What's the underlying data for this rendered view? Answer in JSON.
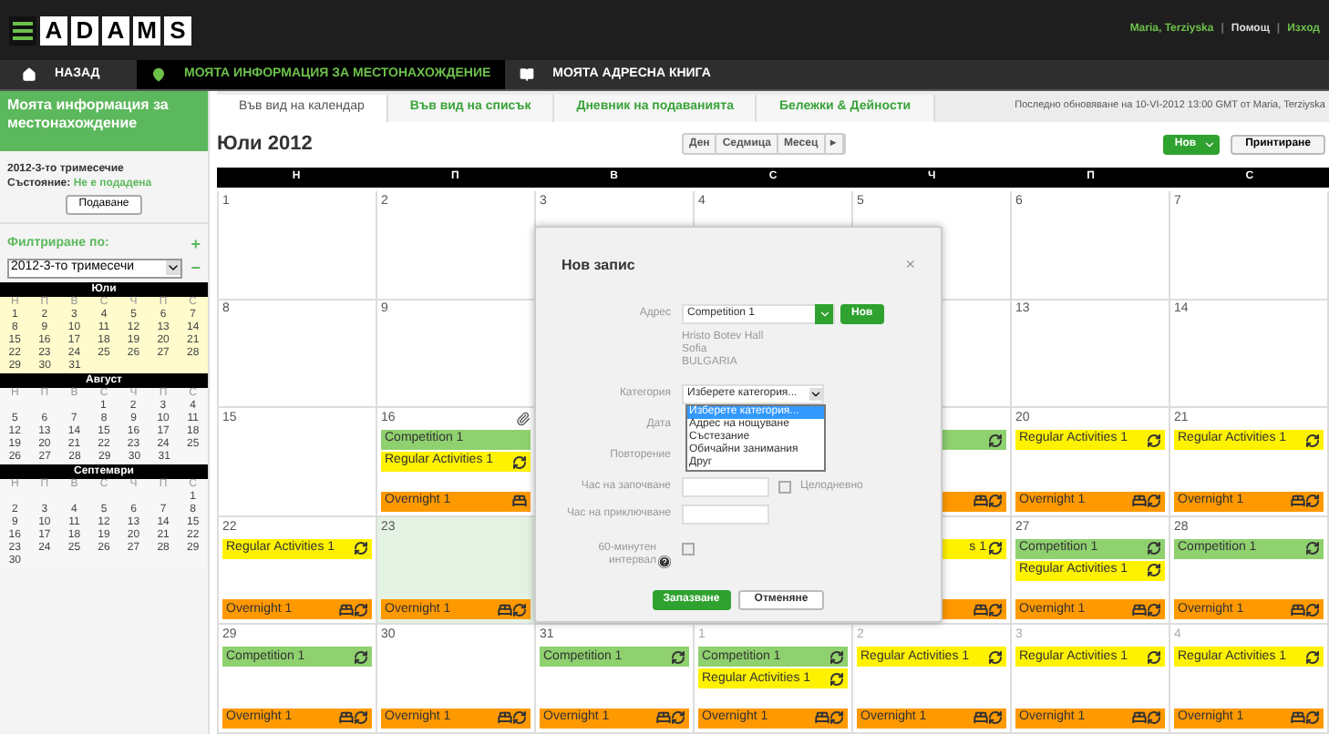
{
  "header": {
    "logo": [
      "A",
      "D",
      "A",
      "M",
      "S"
    ],
    "user": "Maria, Terziyska",
    "separators": [
      "|",
      "|"
    ],
    "links": [
      "Помощ",
      "Изход"
    ]
  },
  "nav": [
    {
      "kind": "home",
      "label": "НАЗАД",
      "selected": false
    },
    {
      "kind": "pin",
      "label": "МОЯТА ИНФОРМАЦИЯ ЗА МЕСТОНАХОЖДЕНИЕ",
      "selected": true
    },
    {
      "kind": "book",
      "label": "МОЯТА АДРЕСНА КНИГА",
      "selected": false
    }
  ],
  "sidebar": {
    "title": "Моята информация за местонахождение",
    "quarter": "2012-3-то тримесечие",
    "status_label": "Състояние:",
    "status_value": "Не е подадена",
    "submit": "Подаване",
    "filter_label": "Филтриране по:",
    "add": "+",
    "remove": "−",
    "filter_value": "2012-3-то тримесечи",
    "months": [
      {
        "name": "Юли",
        "selected": true,
        "weekdays": [
          "Н",
          "П",
          "В",
          "С",
          "Ч",
          "П",
          "С"
        ],
        "weeks": [
          {
            "days": [
              "1",
              "2",
              "3",
              "4",
              "5",
              "6",
              "7"
            ]
          },
          {
            "days": [
              "8",
              "9",
              "10",
              "11",
              "12",
              "13",
              "14"
            ]
          },
          {
            "days": [
              "15",
              "16",
              "17",
              "18",
              "19",
              "20",
              "21"
            ]
          },
          {
            "days": [
              "22",
              "23",
              "24",
              "25",
              "26",
              "27",
              "28"
            ]
          },
          {
            "days": [
              "29",
              "30",
              "31"
            ]
          }
        ]
      },
      {
        "name": "Август",
        "selected": false,
        "weekdays": [
          "Н",
          "П",
          "В",
          "С",
          "Ч",
          "П",
          "С"
        ],
        "weeks": [
          {
            "pad_start": true,
            "days": [
              "1",
              "2",
              "3",
              "4"
            ]
          },
          {
            "days": [
              "5",
              "6",
              "7",
              "8",
              "9",
              "10",
              "11"
            ]
          },
          {
            "days": [
              "12",
              "13",
              "14",
              "15",
              "16",
              "17",
              "18"
            ]
          },
          {
            "days": [
              "19",
              "20",
              "21",
              "22",
              "23",
              "24",
              "25"
            ]
          },
          {
            "days": [
              "26",
              "27",
              "28",
              "29",
              "30",
              "31"
            ]
          }
        ]
      },
      {
        "name": "Септември",
        "selected": false,
        "weekdays": [
          "Н",
          "П",
          "В",
          "С",
          "Ч",
          "П",
          "С"
        ],
        "weeks": [
          {
            "pad_start": true,
            "days": [
              "1"
            ]
          },
          {
            "days": [
              "2",
              "3",
              "4",
              "5",
              "6",
              "7",
              "8"
            ]
          },
          {
            "days": [
              "9",
              "10",
              "11",
              "12",
              "13",
              "14",
              "15"
            ]
          },
          {
            "days": [
              "16",
              "17",
              "18",
              "19",
              "20",
              "21",
              "22"
            ]
          },
          {
            "days": [
              "23",
              "24",
              "25",
              "26",
              "27",
              "28",
              "29"
            ]
          },
          {
            "days": [
              "30"
            ]
          }
        ]
      }
    ]
  },
  "tabs": [
    {
      "label": "Във вид на календар",
      "selected": true
    },
    {
      "label": "Във вид на списък",
      "selected": false
    },
    {
      "label": "Дневник на подаванията",
      "selected": false
    },
    {
      "label": "Бележки & Дейности",
      "selected": false
    }
  ],
  "last_updated": "Последно обновяване на 10-VI-2012 13:00 GMT от Maria, Terziyska",
  "toolbar": {
    "title": "Юли 2012",
    "views": [
      "Ден",
      "Седмица",
      "Месец",
      "▸"
    ],
    "new": "Нов",
    "print": "Принтиране"
  },
  "calendar": {
    "weekdays": [
      "Н",
      "П",
      "В",
      "С",
      "Ч",
      "П",
      "С"
    ],
    "weeks": [
      {
        "days": [
          {
            "day": "1",
            "selected": false,
            "other_month": false
          },
          {
            "day": "2",
            "selected": false,
            "other_month": false
          },
          {
            "day": "3",
            "selected": false,
            "other_month": false
          },
          {
            "day": "4",
            "selected": false,
            "other_month": false
          },
          {
            "day": "5",
            "selected": false,
            "other_month": false
          },
          {
            "day": "6",
            "selected": false,
            "other_month": false
          },
          {
            "day": "7",
            "selected": false,
            "other_month": false
          }
        ]
      },
      {
        "covered": true,
        "days": [
          {
            "day": "8",
            "selected": false,
            "other_month": false
          },
          {
            "day": "9",
            "selected": false,
            "other_month": false
          },
          {
            "selected": false
          },
          {
            "day": "13",
            "selected": false,
            "other_month": false
          },
          {
            "day": "14",
            "selected": false,
            "other_month": false
          }
        ]
      },
      {
        "covered": true,
        "days": [
          {
            "day": "15",
            "selected": false,
            "other_month": false
          },
          {
            "day": "16",
            "selected": false,
            "other_month": false,
            "attachment": true,
            "events": [
              {
                "kind": "competition",
                "label": "Competition 1",
                "recurring": false
              },
              {
                "kind": "regular",
                "label": "Regular Activities 1",
                "recurring": true
              },
              {
                "kind": "overnight",
                "label": "Overnight 1",
                "recurring": false
              }
            ]
          },
          {
            "selected": false,
            "events": [
              {
                "kind": "competition",
                "recurring": true
              },
              {
                "kind": "overnight",
                "recurring": true
              }
            ]
          },
          {
            "day": "20",
            "selected": false,
            "other_month": false,
            "events": [
              {
                "kind": "regular",
                "label": "Regular Activities 1",
                "recurring": true
              },
              {
                "kind": "overnight",
                "label": "Overnight 1",
                "recurring": true
              }
            ]
          },
          {
            "day": "21",
            "selected": false,
            "other_month": false,
            "events": [
              {
                "kind": "regular",
                "label": "Regular Activities 1",
                "recurring": true
              },
              {
                "kind": "overnight",
                "label": "Overnight 1",
                "recurring": true
              }
            ]
          }
        ]
      },
      {
        "covered": true,
        "days": [
          {
            "day": "22",
            "selected": false,
            "other_month": false,
            "events": [
              {
                "kind": "regular",
                "label": "Regular Activities 1",
                "recurring": true
              },
              {
                "kind": "overnight",
                "label": "Overnight 1",
                "recurring": true
              }
            ]
          },
          {
            "day": "23",
            "selected": true,
            "other_month": false,
            "events": [
              {
                "kind": "overnight",
                "label": "Overnight 1",
                "recurring": true
              }
            ]
          },
          {
            "selected": false,
            "events": [
              {
                "kind": "regular",
                "label": "s 1",
                "clipped": true,
                "recurring": true
              },
              {
                "kind": "overnight",
                "recurring": true
              }
            ]
          },
          {
            "day": "27",
            "selected": false,
            "other_month": false,
            "events": [
              {
                "kind": "competition",
                "label": "Competition 1",
                "recurring": true
              },
              {
                "kind": "regular",
                "label": "Regular Activities 1",
                "recurring": true
              },
              {
                "kind": "overnight",
                "label": "Overnight 1",
                "recurring": true
              }
            ]
          },
          {
            "day": "28",
            "selected": false,
            "other_month": false,
            "events": [
              {
                "kind": "competition",
                "label": "Competition 1",
                "recurring": true
              },
              {
                "kind": "overnight",
                "label": "Overnight 1",
                "recurring": true
              }
            ]
          }
        ]
      },
      {
        "days": [
          {
            "day": "29",
            "selected": false,
            "other_month": false,
            "events": [
              {
                "kind": "competition",
                "label": "Competition 1",
                "recurring": true
              },
              {
                "kind": "overnight",
                "label": "Overnight 1",
                "recurring": true
              }
            ]
          },
          {
            "day": "30",
            "selected": false,
            "other_month": false,
            "events": [
              {
                "kind": "overnight",
                "label": "Overnight 1",
                "recurring": true
              }
            ]
          },
          {
            "day": "31",
            "selected": false,
            "other_month": false,
            "events": [
              {
                "kind": "competition",
                "label": "Competition 1",
                "recurring": true
              },
              {
                "kind": "overnight",
                "label": "Overnight 1",
                "recurring": true
              }
            ]
          },
          {
            "day": "1",
            "selected": false,
            "other_month": true,
            "events": [
              {
                "kind": "competition",
                "label": "Competition 1",
                "recurring": true
              },
              {
                "kind": "regular",
                "label": "Regular Activities 1",
                "recurring": true
              },
              {
                "kind": "overnight",
                "label": "Overnight 1",
                "recurring": true
              }
            ]
          },
          {
            "day": "2",
            "selected": false,
            "other_month": true,
            "events": [
              {
                "kind": "regular",
                "label": "Regular Activities 1",
                "recurring": true
              },
              {
                "kind": "overnight",
                "label": "Overnight 1",
                "recurring": true
              }
            ]
          },
          {
            "day": "3",
            "selected": false,
            "other_month": true,
            "events": [
              {
                "kind": "regular",
                "label": "Regular Activities 1",
                "recurring": true
              },
              {
                "kind": "overnight",
                "label": "Overnight 1",
                "recurring": true
              }
            ]
          },
          {
            "day": "4",
            "selected": false,
            "other_month": true,
            "events": [
              {
                "kind": "regular",
                "label": "Regular Activities 1",
                "recurring": true
              },
              {
                "kind": "overnight",
                "label": "Overnight 1",
                "recurring": true
              }
            ]
          }
        ]
      }
    ]
  },
  "dialog": {
    "title": "Нов запис",
    "close": "×",
    "address_label": "Адрес",
    "address_value": "Competition 1",
    "new": "Нов",
    "address_lines": [
      "Hristo Botev Hall",
      "Sofia",
      "BULGARIA"
    ],
    "category_label": "Категория",
    "category_value": "Изберете категория...",
    "category_options": [
      {
        "label": "Изберете категория...",
        "selected": true
      },
      {
        "label": "Адрес на нощуване",
        "selected": false
      },
      {
        "label": "Състезание",
        "selected": false
      },
      {
        "label": "Обичайни занимания",
        "selected": false
      },
      {
        "label": "Друг",
        "selected": false
      }
    ],
    "date_label": "Дата",
    "repeat_label": "Повторение",
    "start_label": "Час на започване",
    "all_day_label": "Целодневно",
    "all_day": false,
    "end_label": "Час на приключване",
    "interval_label": "60-минутен интервал",
    "interval": false,
    "save": "Запазване",
    "cancel": "Отменяне"
  }
}
